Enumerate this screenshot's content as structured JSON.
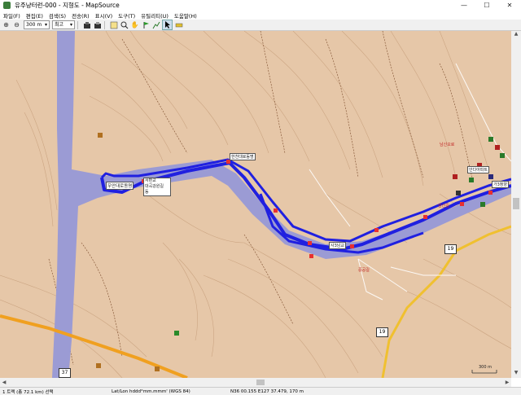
{
  "window": {
    "title": "유주냥터런-000 - 지형도 - MapSource",
    "minimize": "—",
    "maximize": "☐",
    "close": "✕"
  },
  "menu": {
    "items": [
      "파일(F)",
      "편집(E)",
      "검색(S)",
      "전송(R)",
      "표시(V)",
      "도구(T)",
      "유틸리티(U)",
      "도움말(H)"
    ]
  },
  "toolbar": {
    "zoom_in": "⊕",
    "zoom_out": "⊖",
    "scale_value": "300 m",
    "detail_value": "최고"
  },
  "map": {
    "labels": {
      "north_bridge": "우안대로동명",
      "popup_line1": "서편교",
      "popup_line2": "대곡강원길",
      "popup_line3": "동",
      "right_mid_box": "안다아파트",
      "river_label": "한천대로동명",
      "right_edge_box": "가3청양",
      "right_node": "삼산길",
      "jct_label": "사3남교",
      "hwy19a": "19",
      "hwy19b": "19",
      "hwy37": "37",
      "lower_road": "중공길",
      "right_cluster": "남신오로"
    },
    "scale_label": "300 m"
  },
  "status": {
    "track": "1 트랙 (총 72.1 km) 선택",
    "format": "Lat/Lon hddd°mm.mmm' (WGS 84)",
    "coords": "N36 00.155 E127 37.479, 170 m"
  },
  "colors": {
    "terrain": "#e6c7a8",
    "river": "#9b9bd4",
    "track": "#2020e0",
    "highway": "#f0a020"
  }
}
